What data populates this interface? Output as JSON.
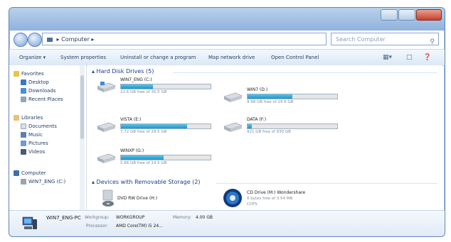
{
  "address": {
    "path": "▸ Computer ▸"
  },
  "search": {
    "placeholder": "Search Computer"
  },
  "toolbar": {
    "organize": "Organize ▾",
    "system_properties": "System properties",
    "uninstall": "Uninstall or change a program",
    "map_drive": "Map network drive",
    "control_panel": "Open Control Panel"
  },
  "sidebar": {
    "items": [
      {
        "label": "Favorites"
      },
      {
        "label": "Desktop"
      },
      {
        "label": "Downloads"
      },
      {
        "label": "Recent Places"
      },
      {
        "label": "Libraries"
      },
      {
        "label": "Documents"
      },
      {
        "label": "Music"
      },
      {
        "label": "Pictures"
      },
      {
        "label": "Videos"
      },
      {
        "label": "Computer"
      },
      {
        "label": "WIN7_ENG (C:)"
      }
    ]
  },
  "hard_disks": {
    "title": "▴ Hard Disk Drives (5)",
    "drives": [
      {
        "name": "WIN7_ENG (C:)",
        "free": "22.6 GB free of 35.5 GB",
        "used_fraction": 0.36
      },
      {
        "name": "WIN7 (D:)",
        "free": "9.98 GB free of 19.9 GB",
        "used_fraction": 0.5
      },
      {
        "name": "VISTA (E:)",
        "free": "7.72 GB free of 29.5 GB",
        "used_fraction": 0.74
      },
      {
        "name": "DATA (F:)",
        "free": "921 GB free of 930 GB",
        "used_fraction": 0.05
      },
      {
        "name": "WINXP (G:)",
        "free": "5.66 GB free of 14.5 GB",
        "used_fraction": 0.48
      }
    ]
  },
  "removable": {
    "title": "▴ Devices with Removable Storage (2)",
    "dvd": {
      "name": "DVD RW Drive (H:)"
    },
    "cd": {
      "name": "CD Drive (M:) Wondershare",
      "free": "0 bytes free of 3.54 MB",
      "fs": "CDFS"
    }
  },
  "details": {
    "pc_name": "WIN7_ENG-PC",
    "workgroup_label": "Workgroup:",
    "workgroup": "WORKGROUP",
    "memory_label": "Memory:",
    "memory": "4.00 GB",
    "processor_label": "Processor:",
    "processor": "AMD Core(TM) i5 24..."
  },
  "colors": {
    "accent": "#1f94c9",
    "link": "#1e3e8a"
  }
}
